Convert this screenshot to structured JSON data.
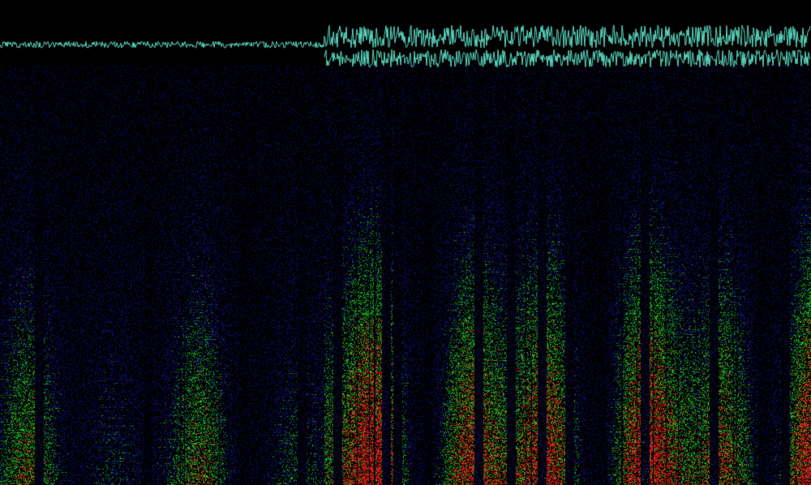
{
  "image": {
    "kind": "spectrogram",
    "background_color": "#000000",
    "palette": {
      "low_energy": "#1a1ab8",
      "mid_energy": "#22e022",
      "high_energy": "#e01818",
      "waveform": "#5fe0c8"
    },
    "sections": [
      {
        "name": "quiet-intro",
        "start_fraction": 0.0,
        "end_fraction": 0.4,
        "intensity": 0.55
      },
      {
        "name": "loud-body",
        "start_fraction": 0.4,
        "end_fraction": 1.0,
        "intensity": 1.0
      }
    ]
  }
}
